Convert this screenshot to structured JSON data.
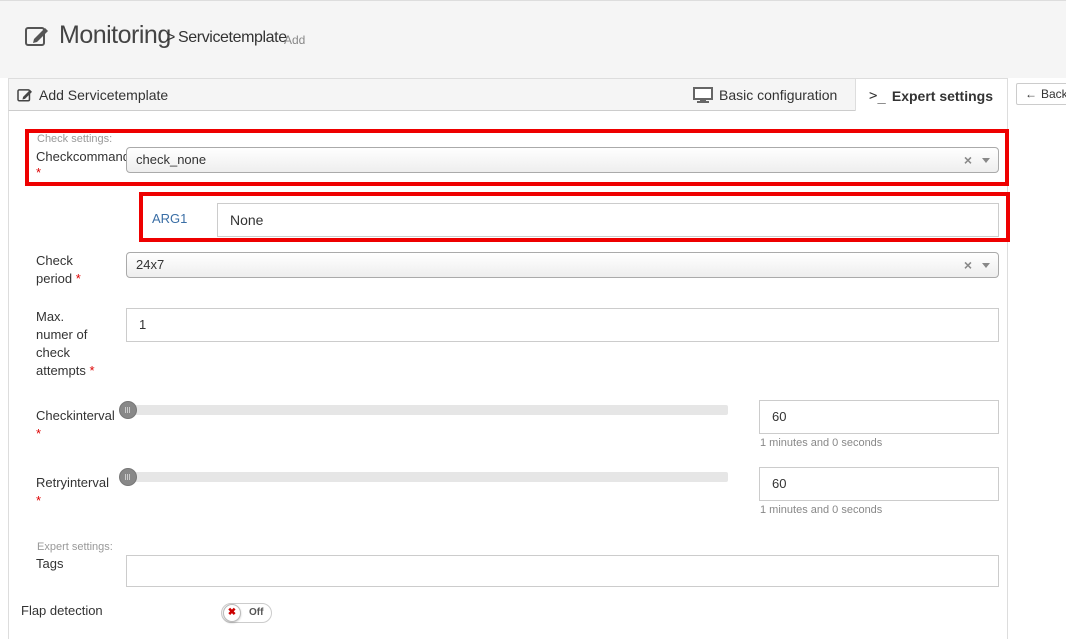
{
  "header": {
    "title": "Monitoring",
    "separator": ">",
    "subtitle": "Servicetemplate",
    "action": "Add",
    "icon": "edit-icon"
  },
  "tabs": {
    "panel_title": "Add Servicetemplate",
    "basic_label": "Basic configuration",
    "expert_label": "Expert settings",
    "back_label": "Back"
  },
  "form": {
    "check_settings_label": "Check settings:",
    "checkcommand": {
      "label": "Checkcommand",
      "required": "*",
      "value": "check_none"
    },
    "arg1": {
      "label": "ARG1",
      "value": "None"
    },
    "check_period": {
      "label_line1": "Check",
      "label_line2": "period",
      "required": "*",
      "value": "24x7"
    },
    "max_attempts": {
      "label_line1": "Max.",
      "label_line2": "numer of",
      "label_line3": "check",
      "label_line4": "attempts",
      "required": "*",
      "value": "1"
    },
    "checkinterval": {
      "label": "Checkinterval",
      "required": "*",
      "value": "60",
      "hint": "1 minutes and 0 seconds"
    },
    "retryinterval": {
      "label": "Retryinterval",
      "required": "*",
      "value": "60",
      "hint": "1 minutes and 0 seconds"
    },
    "expert_settings_label": "Expert settings:",
    "tags": {
      "label": "Tags",
      "value": ""
    },
    "flap_detection": {
      "label": "Flap detection",
      "state": "Off",
      "off_symbol": "✖"
    }
  },
  "colors": {
    "highlight": "#ee0000",
    "required": "#dd0000",
    "arg_label": "#3a6ea5"
  }
}
